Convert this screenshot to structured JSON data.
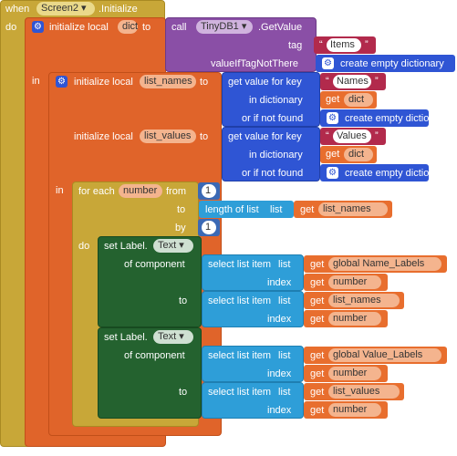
{
  "event": {
    "when": "when",
    "component": "Screen2",
    "method": ".Initialize",
    "do": "do"
  },
  "init_dict": {
    "label": "initialize local",
    "var": "dict",
    "to": "to",
    "call": "call",
    "db": "TinyDB1",
    "method": ".GetValue",
    "tag_label": "tag",
    "tag_value": "Items",
    "default_label": "valueIfTagNotThere",
    "default_value": "create empty dictionary",
    "in": "in"
  },
  "init_lists": {
    "label": "initialize local",
    "var1": "list_names",
    "var2": "list_values",
    "to": "to",
    "get_value_for_key": "get value for key",
    "key1": "Names",
    "key2": "Values",
    "in_dictionary": "in dictionary",
    "get": "get",
    "dict_var": "dict",
    "or_if_not_found": "or if not found",
    "empty_dict": "create empty dictionary",
    "in": "in"
  },
  "for_each": {
    "label": "for each",
    "var": "number",
    "from": "from",
    "from_value": "1",
    "to": "to",
    "length_label": "length of list",
    "list_label": "list",
    "get": "get",
    "list_var": "list_names",
    "by": "by",
    "by_value": "1",
    "do": "do"
  },
  "set_label_1": {
    "set": "set Label.",
    "prop": "Text",
    "of_component": "of component",
    "to": "to",
    "select_item": "select list item",
    "list": "list",
    "index": "index",
    "get": "get",
    "comp_list": "global Name_Labels",
    "index_var": "number",
    "value_list": "list_names"
  },
  "set_label_2": {
    "set": "set Label.",
    "prop": "Text",
    "of_component": "of component",
    "to": "to",
    "select_item": "select list item",
    "list": "list",
    "index": "index",
    "get": "get",
    "comp_list": "global Value_Labels",
    "index_var": "number",
    "value_list": "list_values"
  },
  "colors": {
    "event": "#c8a738",
    "variable": "#e0642a",
    "procedure": "#8a4fa6",
    "text": "#b22a4c",
    "dictionary": "#2f55d4",
    "control": "#c8a738",
    "math": "#3b69b5",
    "lists": "#2e9ed8",
    "component_set": "#24622f",
    "get": "#e86e2e"
  }
}
